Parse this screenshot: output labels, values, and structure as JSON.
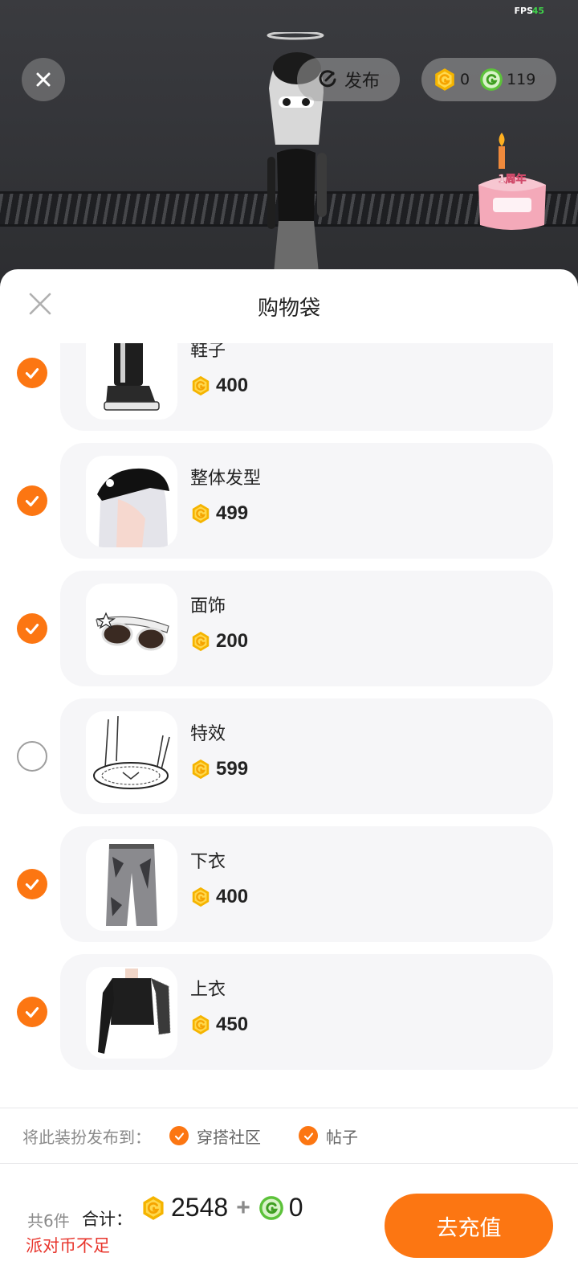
{
  "status": {
    "fps_label": "FPS",
    "fps_value": "45"
  },
  "topbar": {
    "publish_label": "发布",
    "gold_coins": "0",
    "green_coins": "119"
  },
  "cake_badge": "1周年",
  "sheet": {
    "title": "购物袋"
  },
  "items": [
    {
      "name": "鞋子",
      "price": "400",
      "checked": true
    },
    {
      "name": "整体发型",
      "price": "499",
      "checked": true
    },
    {
      "name": "面饰",
      "price": "200",
      "checked": true
    },
    {
      "name": "特效",
      "price": "599",
      "checked": false
    },
    {
      "name": "下衣",
      "price": "400",
      "checked": true
    },
    {
      "name": "上衣",
      "price": "450",
      "checked": true
    }
  ],
  "publish": {
    "label": "将此装扮发布到：",
    "options": [
      {
        "label": "穿搭社区",
        "checked": true
      },
      {
        "label": "帖子",
        "checked": true
      }
    ]
  },
  "footer": {
    "count": "共6件",
    "total_label": "合计：",
    "gold_total": "2548",
    "plus": "+",
    "green_total": "0",
    "warning": "派对币不足",
    "recharge_label": "去充值"
  },
  "colors": {
    "accent": "#fc7612",
    "warning": "#e8352c",
    "gold": "#f5b400",
    "green": "#5cc23a"
  }
}
